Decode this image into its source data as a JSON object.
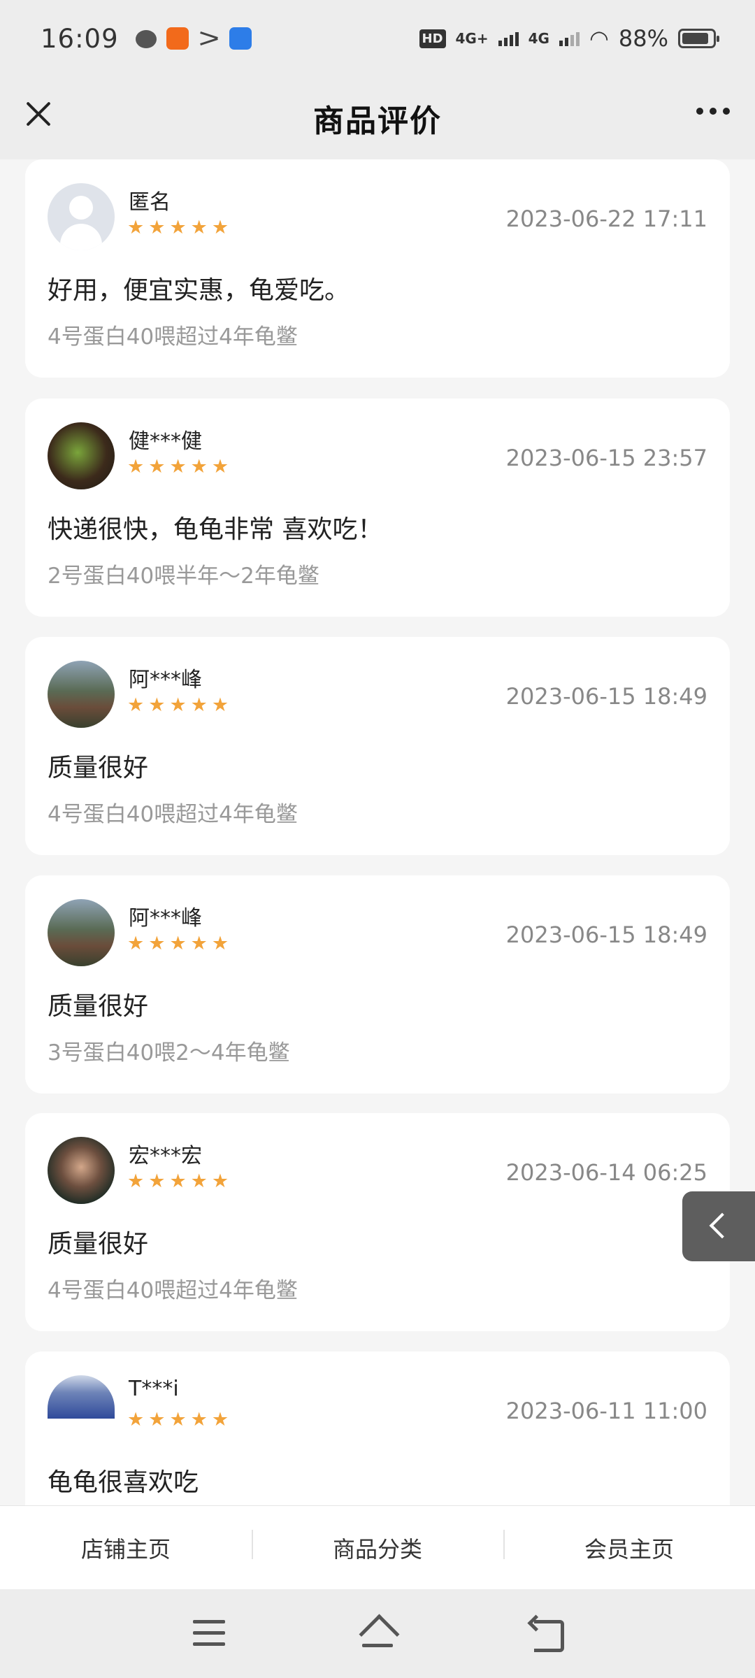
{
  "status_bar": {
    "time": "16:09",
    "network_1": "4G+",
    "network_2": "4G",
    "hd": "HD",
    "battery": "88%",
    "app_icons": [
      "wechat-icon",
      "taobao-icon",
      "mail-icon",
      "clock-icon"
    ]
  },
  "header": {
    "title": "商品评价"
  },
  "reviews": [
    {
      "user": "匿名",
      "rating": 5,
      "date": "2023-06-22 17:11",
      "text": "好用，便宜实惠，龟爱吃。",
      "spec": "4号蛋白40喂超过4年龟鳖"
    },
    {
      "user": "健***健",
      "rating": 5,
      "date": "2023-06-15 23:57",
      "text": "快递很快，龟龟非常 喜欢吃！",
      "spec": "2号蛋白40喂半年～2年龟鳖"
    },
    {
      "user": "阿***峰",
      "rating": 5,
      "date": "2023-06-15 18:49",
      "text": "质量很好",
      "spec": "4号蛋白40喂超过4年龟鳖"
    },
    {
      "user": "阿***峰",
      "rating": 5,
      "date": "2023-06-15 18:49",
      "text": "质量很好",
      "spec": "3号蛋白40喂2～4年龟鳖"
    },
    {
      "user": "宏***宏",
      "rating": 5,
      "date": "2023-06-14 06:25",
      "text": "质量很好",
      "spec": "4号蛋白40喂超过4年龟鳖"
    },
    {
      "user": "T***i",
      "rating": 5,
      "date": "2023-06-11 11:00",
      "text": "龟龟很喜欢吃",
      "spec": ""
    }
  ],
  "shop_menu": {
    "items": [
      "店铺主页",
      "商品分类",
      "会员主页"
    ]
  },
  "colors": {
    "star": "#f2a33a",
    "background": "#f5f5f5",
    "bar": "#ededed"
  }
}
